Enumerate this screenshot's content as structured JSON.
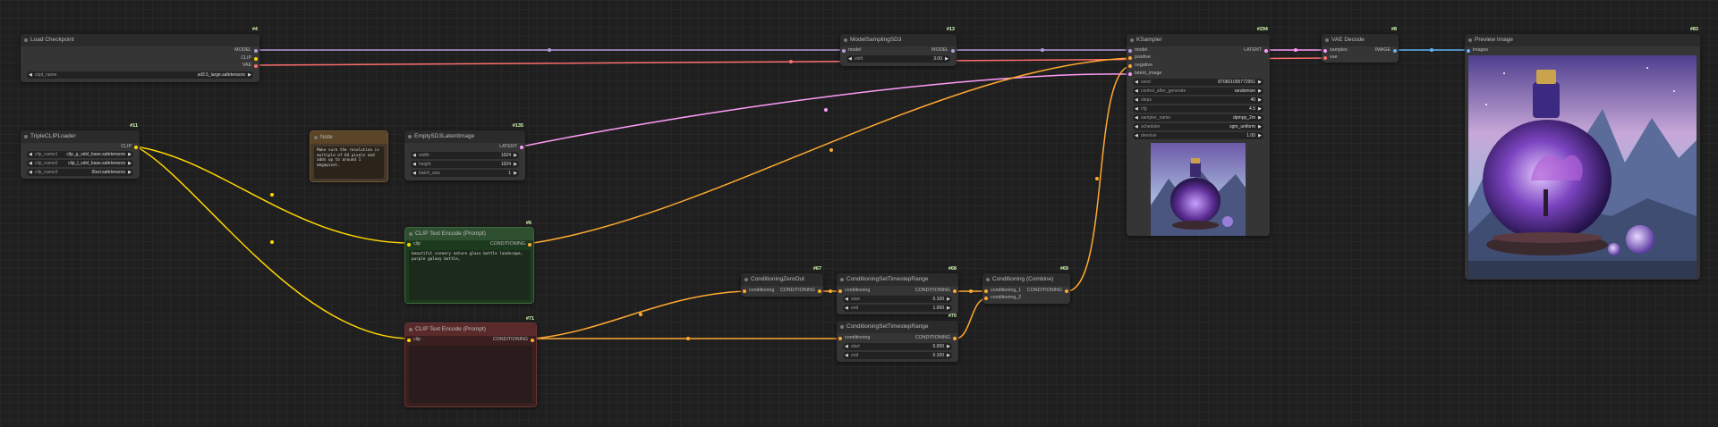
{
  "links_colors": {
    "model": "#b39ddb",
    "clip": "#ffd500",
    "vae": "#ff6e6e",
    "conditioning": "#ffa931",
    "latent": "#ff9cf9",
    "image": "#64b5f6"
  },
  "nodes": {
    "load_checkpoint": {
      "id": "#4",
      "title": "Load Checkpoint",
      "out_model": "MODEL",
      "out_clip": "CLIP",
      "out_vae": "VAE",
      "w_ckpt_label": "ckpt_name",
      "w_ckpt_value": "sd3.5_large.safetensors"
    },
    "model_sampling": {
      "id": "#13",
      "title": "ModelSamplingSD3",
      "in_model": "model",
      "out_model": "MODEL",
      "w_shift_label": "shift",
      "w_shift_value": "3.00"
    },
    "ksampler": {
      "id": "#294",
      "title": "KSampler",
      "in_model": "model",
      "in_positive": "positive",
      "in_negative": "negative",
      "in_latent": "latent_image",
      "out_latent": "LATENT",
      "widgets": [
        {
          "label": "seed",
          "value": "870601095772951"
        },
        {
          "label": "control_after_generate",
          "value": "randomize"
        },
        {
          "label": "steps",
          "value": "40"
        },
        {
          "label": "cfg",
          "value": "4.5"
        },
        {
          "label": "sampler_name",
          "value": "dpmpp_2m"
        },
        {
          "label": "scheduler",
          "value": "sgm_uniform"
        },
        {
          "label": "denoise",
          "value": "1.00"
        }
      ]
    },
    "vae_decode": {
      "id": "#8",
      "title": "VAE Decode",
      "in_samples": "samples",
      "in_vae": "vae",
      "out_image": "IMAGE"
    },
    "preview_image": {
      "id": "#83",
      "title": "Preview Image",
      "in_images": "images"
    },
    "triple_clip": {
      "id": "#11",
      "title": "TripleCLIPLoader",
      "out_clip": "CLIP",
      "widgets": [
        {
          "label": "clip_name1",
          "value": "clip_g_sdxl_base.safetensors"
        },
        {
          "label": "clip_name2",
          "value": "clip_l_sdxl_base.safetensors"
        },
        {
          "label": "clip_name3",
          "value": "t5xxl.safetensors"
        }
      ]
    },
    "note": {
      "title": "Note",
      "text": "Make sure the resolution is multiple of 64 pixels and adds up to around 1 megapixel."
    },
    "empty_latent": {
      "id": "#135",
      "title": "EmptySD3LatentImage",
      "out_latent": "LATENT",
      "widgets": [
        {
          "label": "width",
          "value": "1024"
        },
        {
          "label": "height",
          "value": "1024"
        },
        {
          "label": "batch_size",
          "value": "1"
        }
      ]
    },
    "clip_pos": {
      "id": "#6",
      "title": "CLIP Text Encode (Prompt)",
      "in_clip": "clip",
      "out_cond": "CONDITIONING",
      "text": "beautiful scenery nature glass bottle landscape, purple galaxy bottle,"
    },
    "clip_neg": {
      "id": "#71",
      "title": "CLIP Text Encode (Prompt)",
      "in_clip": "clip",
      "out_cond": "CONDITIONING",
      "text": ""
    },
    "zero_out": {
      "id": "#67",
      "title": "ConditioningZeroOut",
      "in_cond": "conditioning",
      "out_cond": "CONDITIONING"
    },
    "timestep1": {
      "id": "#68",
      "title": "ConditioningSetTimestepRange",
      "in_cond": "conditioning",
      "out_cond": "CONDITIONING",
      "w_start_label": "start",
      "w_start_value": "0.100",
      "w_end_label": "end",
      "w_end_value": "1.000"
    },
    "timestep2": {
      "id": "#70",
      "title": "ConditioningSetTimestepRange",
      "in_cond": "conditioning",
      "out_cond": "CONDITIONING",
      "w_start_label": "start",
      "w_start_value": "0.000",
      "w_end_label": "end",
      "w_end_value": "0.100"
    },
    "combine": {
      "id": "#69",
      "title": "Conditioning (Combine)",
      "in_cond1": "conditioning_1",
      "in_cond2": "conditioning_2",
      "out_cond": "CONDITIONING"
    }
  }
}
